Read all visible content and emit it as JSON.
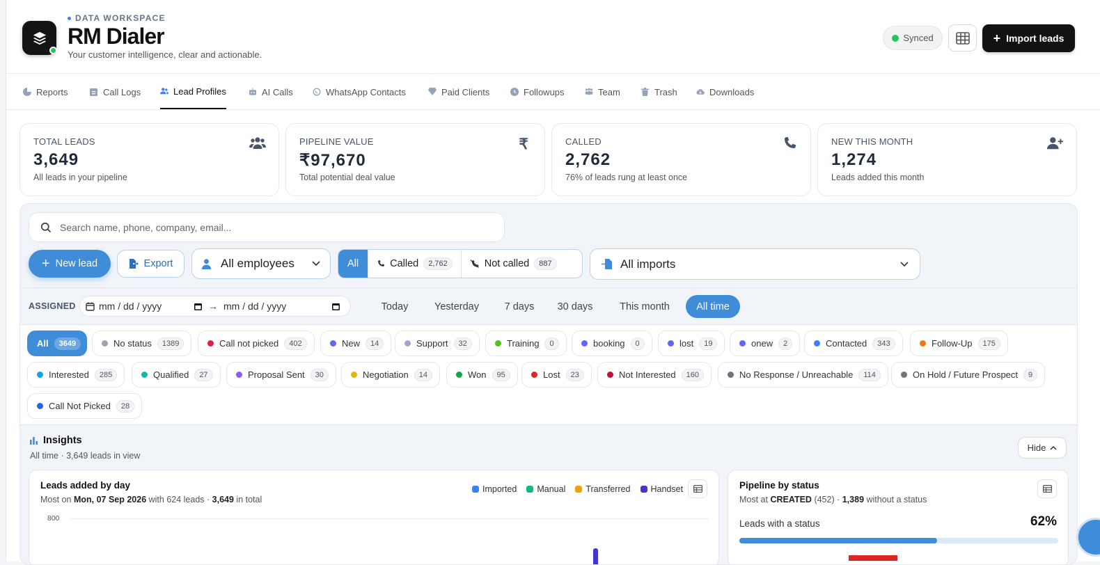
{
  "header": {
    "eyebrow": "DATA WORKSPACE",
    "title": "RM Dialer",
    "subtitle": "Your customer intelligence, clear and actionable.",
    "synced_label": "Synced",
    "import_label": "Import leads"
  },
  "tabs": [
    {
      "label": "Reports",
      "icon": "chart-pie-icon"
    },
    {
      "label": "Call Logs",
      "icon": "clipboard-icon"
    },
    {
      "label": "Lead Profiles",
      "icon": "users-icon",
      "active": true
    },
    {
      "label": "AI Calls",
      "icon": "robot-icon"
    },
    {
      "label": "WhatsApp Contacts",
      "icon": "whatsapp-icon"
    },
    {
      "label": "Paid Clients",
      "icon": "gem-icon"
    },
    {
      "label": "Followups",
      "icon": "clock-icon"
    },
    {
      "label": "Team",
      "icon": "team-icon"
    },
    {
      "label": "Trash",
      "icon": "trash-icon"
    },
    {
      "label": "Downloads",
      "icon": "cloud-download-icon"
    }
  ],
  "stats": [
    {
      "label": "TOTAL LEADS",
      "value": "3,649",
      "caption": "All leads in your pipeline",
      "icon": "users-icon"
    },
    {
      "label": "PIPELINE VALUE",
      "value": "₹97,670",
      "caption": "Total potential deal value",
      "icon": "rupee-icon"
    },
    {
      "label": "CALLED",
      "value": "2,762",
      "caption": "76% of leads rung at least once",
      "icon": "phone-icon"
    },
    {
      "label": "NEW THIS MONTH",
      "value": "1,274",
      "caption": "Leads added this month",
      "icon": "user-plus-icon"
    }
  ],
  "filters": {
    "search_placeholder": "Search name, phone, company, email...",
    "new_lead_label": "New lead",
    "export_label": "Export",
    "employees_value": "All employees",
    "segment": [
      {
        "label": "All",
        "count": ""
      },
      {
        "label": "Called",
        "count": "2,762"
      },
      {
        "label": "Not called",
        "count": "887"
      }
    ],
    "imports_value": "All imports",
    "assigned_label": "ASSIGNED",
    "date_from_placeholder": "mm / dd / yyyy",
    "date_to_placeholder": "mm / dd / yyyy",
    "date_arrow": "→",
    "quick_ranges": [
      "Today",
      "Yesterday",
      "7 days",
      "30 days",
      "This month",
      "All time"
    ],
    "quick_active": "All time"
  },
  "status_chips": [
    {
      "label": "All",
      "count": "3649",
      "color": "",
      "active": true
    },
    {
      "label": "No status",
      "count": "1389",
      "color": "#9ca3af"
    },
    {
      "label": "Call not picked",
      "count": "402",
      "color": "#e11d48"
    },
    {
      "label": "New",
      "count": "14",
      "color": "#6366f1"
    },
    {
      "label": "Support",
      "count": "32",
      "color": "#a5a6c9"
    },
    {
      "label": "Training",
      "count": "0",
      "color": "#52c41a"
    },
    {
      "label": "booking",
      "count": "0",
      "color": "#6366f1"
    },
    {
      "label": "lost",
      "count": "19",
      "color": "#6366f1"
    },
    {
      "label": "onew",
      "count": "2",
      "color": "#6366f1"
    },
    {
      "label": "Contacted",
      "count": "343",
      "color": "#3b82f6"
    },
    {
      "label": "Follow-Up",
      "count": "175",
      "color": "#f97316"
    },
    {
      "label": "Interested",
      "count": "285",
      "color": "#0ea5e9"
    },
    {
      "label": "Qualified",
      "count": "27",
      "color": "#14b8a6"
    },
    {
      "label": "Proposal Sent",
      "count": "30",
      "color": "#8b5cf6"
    },
    {
      "label": "Negotiation",
      "count": "14",
      "color": "#eab308"
    },
    {
      "label": "Won",
      "count": "95",
      "color": "#16a34a"
    },
    {
      "label": "Lost",
      "count": "23",
      "color": "#dc2626"
    },
    {
      "label": "Not Interested",
      "count": "160",
      "color": "#be123c"
    },
    {
      "label": "No Response / Unreachable",
      "count": "114",
      "color": "#6b7280"
    },
    {
      "label": "On Hold / Future Prospect",
      "count": "9",
      "color": "#78716c"
    },
    {
      "label": "Call Not Picked",
      "count": "28",
      "color": "#2563eb"
    }
  ],
  "insights": {
    "title": "Insights",
    "subtitle": "All time · 3,649 leads in view",
    "hide_label": "Hide",
    "leads_by_day": {
      "title": "Leads added by day",
      "sub_prefix": "Most on ",
      "sub_date": "Mon, 07 Sep 2026",
      "sub_mid": " with 624 leads · ",
      "sub_total": "3,649",
      "sub_suffix": " in total",
      "legend": [
        {
          "label": "Imported",
          "color": "#3b82f6"
        },
        {
          "label": "Manual",
          "color": "#10b981"
        },
        {
          "label": "Transferred",
          "color": "#f59e0b"
        },
        {
          "label": "Handset",
          "color": "#4338ca"
        }
      ],
      "y_tick": "800"
    },
    "pipeline": {
      "title": "Pipeline by status",
      "sub_prefix": "Most at ",
      "sub_status": "CREATED",
      "sub_count": " (452) · ",
      "sub_without": "1,389",
      "sub_suffix": " without a status",
      "status_label": "Leads with a status",
      "status_pct": "62%",
      "status_fraction": 0.62
    }
  }
}
